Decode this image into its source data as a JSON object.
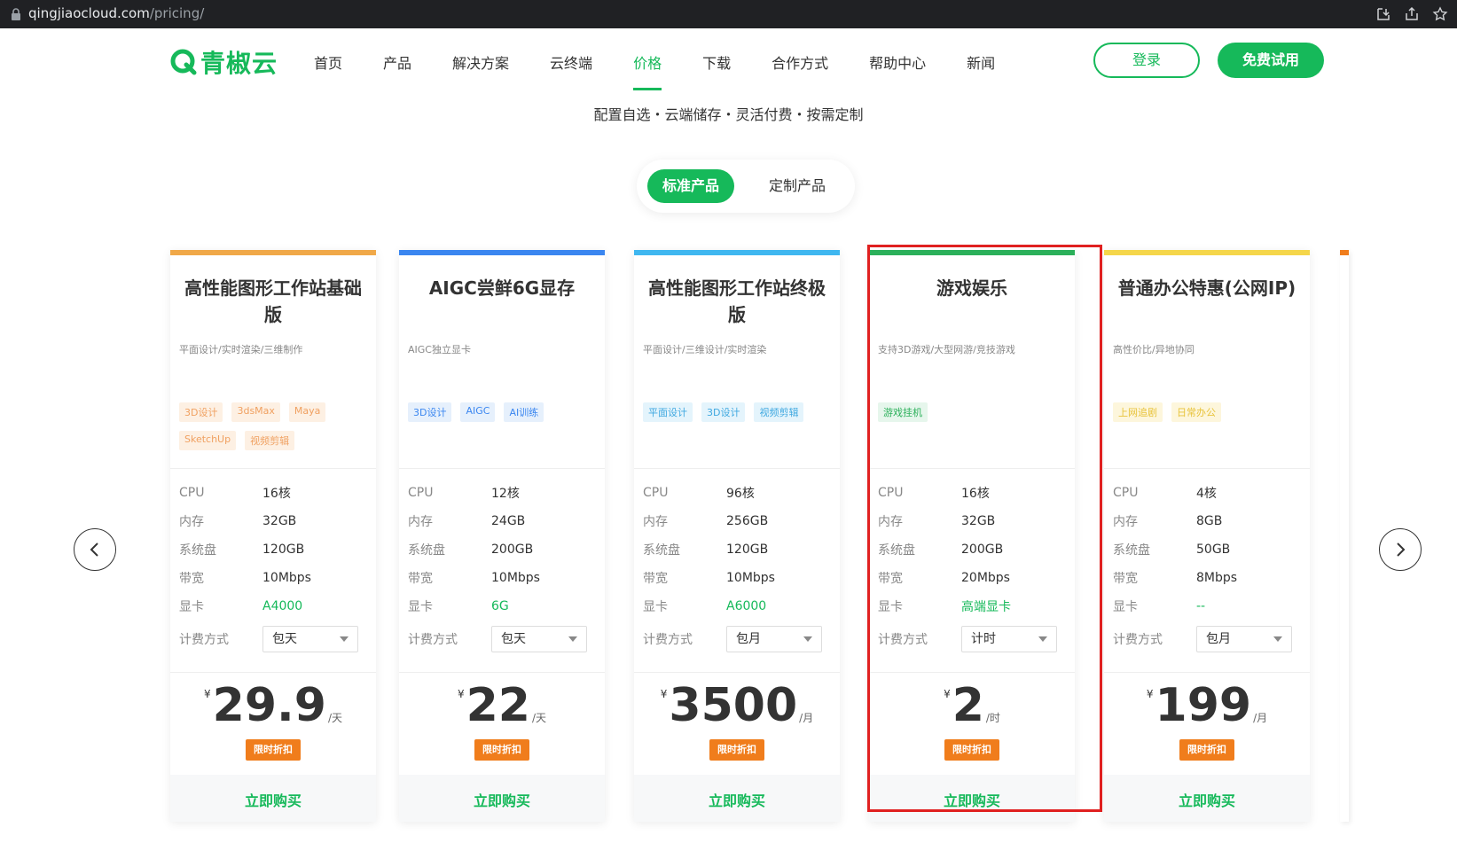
{
  "browser": {
    "url_domain": "qingjiaocloud.com",
    "url_path": "/pricing/"
  },
  "header": {
    "logo_text": "青椒云",
    "nav": [
      {
        "label": "首页",
        "active": false
      },
      {
        "label": "产品",
        "active": false
      },
      {
        "label": "解决方案",
        "active": false
      },
      {
        "label": "云终端",
        "active": false
      },
      {
        "label": "价格",
        "active": true
      },
      {
        "label": "下载",
        "active": false
      },
      {
        "label": "合作方式",
        "active": false
      },
      {
        "label": "帮助中心",
        "active": false
      },
      {
        "label": "新闻",
        "active": false
      }
    ],
    "login_label": "登录",
    "trial_label": "免费试用"
  },
  "tagline": "配置自选・云端储存・灵活付费・按需定制",
  "toggle": {
    "standard": "标准产品",
    "custom": "定制产品"
  },
  "colors": {
    "brand_green": "#16b95a",
    "discount_orange": "#f07d1c",
    "highlight_red": "#e02020"
  },
  "spec_labels": {
    "cpu": "CPU",
    "memory": "内存",
    "disk": "系统盘",
    "bandwidth": "带宽",
    "gpu": "显卡",
    "billing": "计费方式"
  },
  "discount_label": "限时折扣",
  "buy_label": "立即购买",
  "currency_symbol": "¥",
  "cards": [
    {
      "title": "高性能图形工作站基础版",
      "subtitle": "平面设计/实时渲染/三维制作",
      "top_color": "#f0a848",
      "tags": [
        "3D设计",
        "3dsMax",
        "Maya",
        "SketchUp",
        "视频剪辑"
      ],
      "tag_style": "orange",
      "cpu": "16核",
      "memory": "32GB",
      "disk": "120GB",
      "bandwidth": "10Mbps",
      "gpu": "A4000",
      "billing": "包天",
      "price": "29.9",
      "unit": "/天"
    },
    {
      "title": "AIGC尝鲜6G显存",
      "subtitle": "AIGC独立显卡",
      "top_color": "#3a86f0",
      "tags": [
        "3D设计",
        "AIGC",
        "AI训练"
      ],
      "tag_style": "blue",
      "cpu": "12核",
      "memory": "24GB",
      "disk": "200GB",
      "bandwidth": "10Mbps",
      "gpu": "6G",
      "billing": "包天",
      "price": "22",
      "unit": "/天"
    },
    {
      "title": "高性能图形工作站终极版",
      "subtitle": "平面设计/三维设计/实时渲染",
      "top_color": "#3fb7f0",
      "tags": [
        "平面设计",
        "3D设计",
        "视频剪辑"
      ],
      "tag_style": "cyan",
      "cpu": "96核",
      "memory": "256GB",
      "disk": "120GB",
      "bandwidth": "10Mbps",
      "gpu": "A6000",
      "billing": "包月",
      "price": "3500",
      "unit": "/月"
    },
    {
      "title": "游戏娱乐",
      "subtitle": "支持3D游戏/大型网游/竞技游戏",
      "top_color": "#2bb05a",
      "tags": [
        "游戏挂机"
      ],
      "tag_style": "green",
      "cpu": "16核",
      "memory": "32GB",
      "disk": "200GB",
      "bandwidth": "20Mbps",
      "gpu": "高端显卡",
      "billing": "计时",
      "price": "2",
      "unit": "/时"
    },
    {
      "title": "普通办公特惠(公网IP)",
      "subtitle": "高性价比/异地协同",
      "top_color": "#f5d64a",
      "tags": [
        "上网追剧",
        "日常办公"
      ],
      "tag_style": "yellow",
      "cpu": "4核",
      "memory": "8GB",
      "disk": "50GB",
      "bandwidth": "8Mbps",
      "gpu": "--",
      "billing": "包月",
      "price": "199",
      "unit": "/月"
    }
  ]
}
